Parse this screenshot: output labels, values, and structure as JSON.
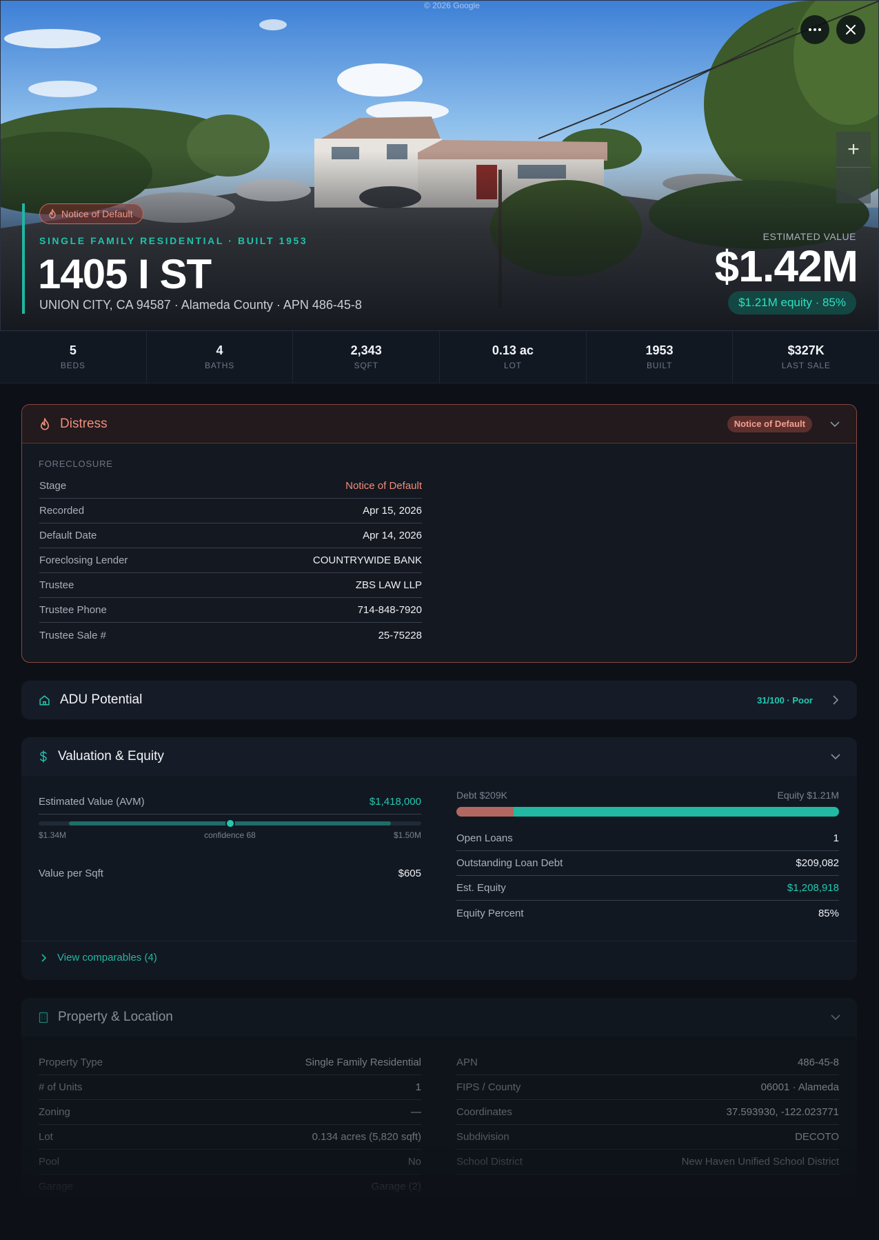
{
  "hero": {
    "copyright": "© 2026 Google",
    "distress_tag": "Notice of Default",
    "property_type_line": "SINGLE FAMILY RESIDENTIAL · BUILT 1953",
    "address": "1405 I ST",
    "sub_address": "UNION CITY, CA 94587 · Alameda County · APN 486-45-8",
    "estimated_label": "ESTIMATED VALUE",
    "estimated_value": "$1.42M",
    "equity_pill": "$1.21M equity · 85%",
    "more_icon": "more-horizontal-icon",
    "close_icon": "close-icon",
    "zoom_in": "+"
  },
  "stats": [
    {
      "value": "5",
      "label": "BEDS"
    },
    {
      "value": "4",
      "label": "BATHS"
    },
    {
      "value": "2,343",
      "label": "SQFT"
    },
    {
      "value": "0.13 ac",
      "label": "LOT"
    },
    {
      "value": "1953",
      "label": "BUILT"
    },
    {
      "value": "$327K",
      "label": "LAST SALE"
    }
  ],
  "distress": {
    "title": "Distress",
    "badge": "Notice of Default",
    "section_label": "FORECLOSURE",
    "rows": [
      {
        "key": "Stage",
        "value": "Notice of Default"
      },
      {
        "key": "Recorded",
        "value": "Apr 15, 2026"
      },
      {
        "key": "Default Date",
        "value": "Apr 14, 2026"
      },
      {
        "key": "Foreclosing Lender",
        "value": "COUNTRYWIDE BANK"
      },
      {
        "key": "Trustee",
        "value": "ZBS LAW LLP"
      },
      {
        "key": "Trustee Phone",
        "value": "714-848-7920"
      },
      {
        "key": "Trustee Sale #",
        "value": "25-75228"
      }
    ]
  },
  "adu": {
    "title": "ADU Potential",
    "score": "31/100 · Poor"
  },
  "valuation": {
    "title": "Valuation & Equity",
    "avm_label": "Estimated Value (AVM)",
    "avm_value": "$1,418,000",
    "range_low": "$1.34M",
    "range_high": "$1.50M",
    "confidence": "confidence 68",
    "range_fill_start": 0.08,
    "range_fill_end": 0.92,
    "range_marker": 0.5,
    "value_per_sqft_label": "Value per Sqft",
    "value_per_sqft": "$605",
    "debt_label": "Debt $209K",
    "equity_label": "Equity $1.21M",
    "debt_fraction": 0.15,
    "rows": [
      {
        "key": "Open Loans",
        "value": "1"
      },
      {
        "key": "Outstanding Loan Debt",
        "value": "$209,082"
      },
      {
        "key": "Est. Equity",
        "value": "$1,208,918"
      },
      {
        "key": "Equity Percent",
        "value": "85%"
      }
    ],
    "comparables_link": "View comparables (4)"
  },
  "property": {
    "title": "Property & Location",
    "left_rows": [
      {
        "key": "Property Type",
        "value": "Single Family Residential"
      },
      {
        "key": "# of Units",
        "value": "1"
      },
      {
        "key": "Zoning",
        "value": "—"
      },
      {
        "key": "Lot",
        "value": "0.134 acres (5,820 sqft)"
      },
      {
        "key": "Pool",
        "value": "No"
      },
      {
        "key": "Garage",
        "value": "Garage (2)"
      }
    ],
    "right_rows": [
      {
        "key": "APN",
        "value": "486-45-8"
      },
      {
        "key": "FIPS / County",
        "value": "06001 · Alameda"
      },
      {
        "key": "Coordinates",
        "value": "37.593930, -122.023771"
      },
      {
        "key": "Subdivision",
        "value": "DECOTO"
      },
      {
        "key": "School District",
        "value": "New Haven Unified School District"
      }
    ]
  },
  "colors": {
    "accent_teal": "#22c9b0",
    "distress_red": "#f08d7c",
    "debt_red": "#b26761",
    "background": "#0d1117"
  }
}
